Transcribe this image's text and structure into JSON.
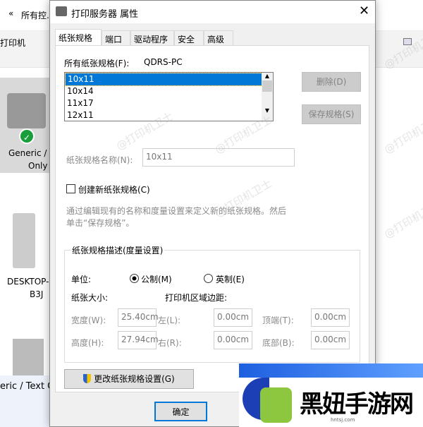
{
  "background": {
    "breadcrumb": "所有控...",
    "back_label": "«",
    "toolbar_item": "打印机",
    "devices": [
      {
        "name": "Generic / Text Only",
        "line1": "Generic /",
        "line2": "Only"
      },
      {
        "name": "DESKTOP-B3J",
        "line1": "DESKTOP-",
        "line2": "B3J"
      },
      {
        "name": "Generic / Text Only",
        "line1": "eric / Text O"
      }
    ],
    "watermark": "@打印机卫士"
  },
  "dialog": {
    "title": "打印服务器 属性",
    "tabs": [
      {
        "label": "纸张规格",
        "selected": true
      },
      {
        "label": "端口"
      },
      {
        "label": "驱动程序"
      },
      {
        "label": "安全"
      },
      {
        "label": "高级"
      }
    ],
    "all_forms_label": "所有纸张规格(F):",
    "server_name": "QDRS-PC",
    "forms": [
      "10x11",
      "10x14",
      "11x17",
      "12x11"
    ],
    "selected_form": "10x11",
    "delete_button": "删除(D)",
    "save_button": "保存规格(S)",
    "form_name_label": "纸张规格名称(N):",
    "form_name_value": "10x11",
    "create_new_label": "创建新纸张规格(C)",
    "create_new_checked": false,
    "hint": "通过编辑现有的名称和度量设置来定义新的纸张规格。然后单击“保存规格”。",
    "group_title": "纸张规格描述(度量设置)",
    "unit_label": "单位:",
    "unit_metric": "公制(M)",
    "unit_imperial": "英制(E)",
    "unit_selected": "metric",
    "paper_size_label": "纸张大小:",
    "margins_label": "打印机区域边距:",
    "width_label": "宽度(W):",
    "width_value": "25.40cm",
    "height_label": "高度(H):",
    "height_value": "27.94cm",
    "left_label": "左(L):",
    "left_value": "0.00cm",
    "right_label": "右(R):",
    "right_value": "0.00cm",
    "top_label": "顶端(T):",
    "top_value": "0.00cm",
    "bottom_label": "底部(B):",
    "bottom_value": "0.00cm",
    "change_settings_button": "更改纸张规格设置(G)",
    "ok_button": "确定"
  },
  "logo": {
    "text": "黑妞手游网",
    "sub": "hntsj.com"
  },
  "colors": {
    "selection": "#0078d7",
    "accent_green": "#8dc63f"
  }
}
